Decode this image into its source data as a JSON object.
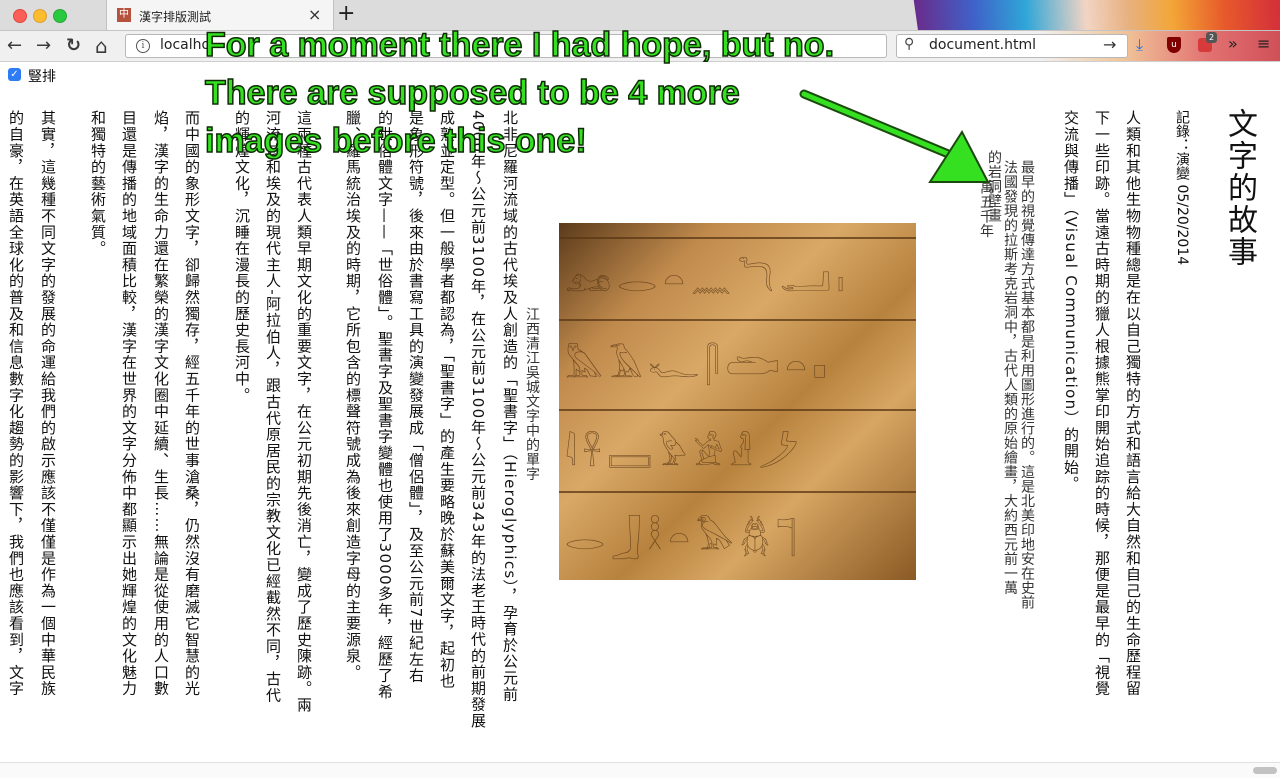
{
  "browser": {
    "tab_title": "漢字排版測試",
    "tab_favicon_glyph": "中",
    "url": "localho",
    "search_text": "document.html",
    "ext_badge": "2",
    "ublock_label": "u"
  },
  "page": {
    "toggle_label": "豎排",
    "title": "文字的故事",
    "byline": "記錄：演變 05/20/2014",
    "columns": [
      "人類和其他生物物種總是在以自己獨特的方式和語言給大自然和自己的生命歷程留",
      "下一些印跡。當遠古時期的獵人根據熊掌印開始追踪的時候，那便是最早的「視覺",
      "交流與傳播」（Visual Communication）的開始。",
      "最早的視覺傳達方式基本都是利用圖形進行的。這是北美印地安在史前",
      "法國發現的拉斯考克岩洞中，古代人類的原始繪畫，大約西元前一萬",
      "的岩洞壁畫",
      "萬五千年",
      "北非尼羅河流域的古代埃及人創造的「聖書字」（Hieroglyphics），孕育於公元前",
      "4000年～公元前3100年，在公元前3100年～公元前343年的法老王時代的前期發展",
      "成熟並定型。但一般學者都認為，「聖書字」的產生要略晚於蘇美爾文字，起初也",
      "是象形符號，後來由於書寫工具的演變發展成「僧侶體」，及至公元前7世紀左右",
      "的世俗體文字——「世俗體」。聖書字及聖書字變體也使用了3000多年，經歷了希",
      "臘、羅馬統治埃及的時期，它所包含的標聲符號成為後來創造字母的主要源泉。",
      "這兩種古代表人類早期文化的重要文字，在公元初期先後消亡，變成了歷史陳跡。兩",
      "河流域和埃及的現代主人-阿拉伯人，跟古代原居民的宗教文化已經截然不同，古代",
      "的輝煌文化，沉睡在漫長的歷史長河中。",
      "而中國的象形文字，卻歸然獨存，經五千年的世事滄桑，仍然沒有磨滅它智慧的光",
      "焰，漢字的生命力還在繁榮的漢字文化圈中延續、生長……無論是從使用的人口數",
      "目還是傳播的地域面積比較，漢字在世界的文字分佈中都顯示出她輝煌的文化魅力",
      "和獨特的藝術氣質。",
      "其實，這幾種不同文字的發展的命運給我們的啟示應該不僅僅是作為一個中華民族",
      "的自豪，在英語全球化的普及和信息數字化趨勢的影響下，我們也應該看到，文字"
    ],
    "image_caption": "江西清江吳城文字中的單字"
  },
  "annotation": {
    "lines": [
      "For a moment there I had hope, but no.",
      "There are supposed to be 4 more",
      "images before this one!"
    ]
  },
  "icons": {
    "back": "←",
    "forward": "→",
    "reload": "↻",
    "home": "⌂",
    "info": "i",
    "search": "⚲",
    "go": "→",
    "download": "⤓",
    "overflow": "»",
    "menu": "≡",
    "close": "×",
    "new_tab": "+",
    "check": "✓"
  },
  "glyph_rows": [
    "𓃭𓂋𓏏𓈖𓆓𓂝𓏤",
    "𓅓𓄿𓆑𓋴𓂧𓏏𓊪",
    "𓇋𓋹𓈙𓅱𓀀𓁐𓌳",
    "𓂋𓃀𓎛𓏏𓅃𓆣𓊹"
  ]
}
